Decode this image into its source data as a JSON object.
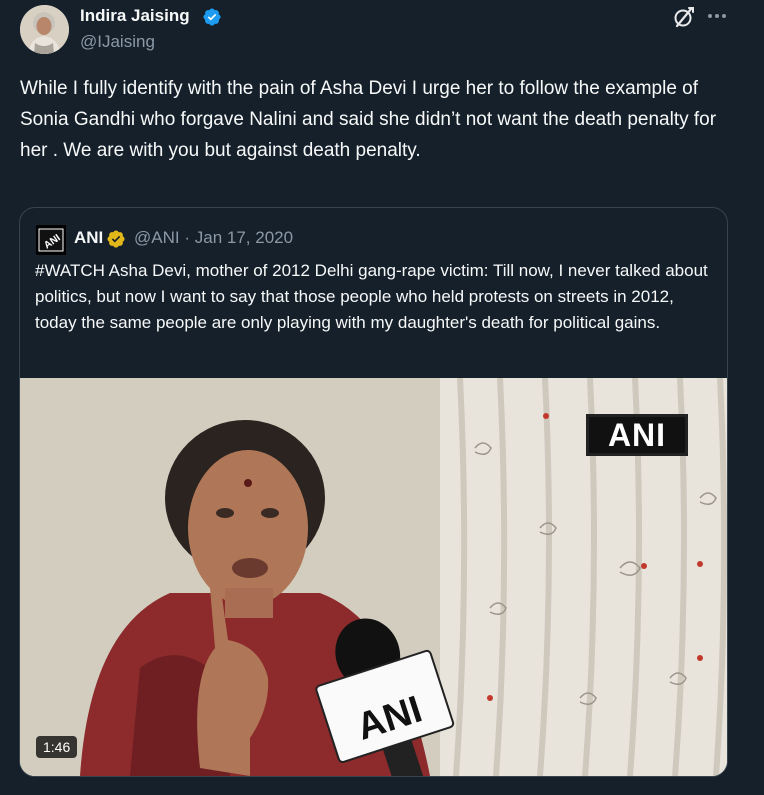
{
  "tweet": {
    "author_name": "Indira Jaising",
    "handle": "@IJaising",
    "text": "While I fully identify with the pain of Asha Devi I urge her to follow the example of Sonia Gandhi who forgave Nalini and said she didn’t not want the death penalty for her . We are with you but against death penalty.",
    "avatar_icon": "profile-photo",
    "verified_color": "#1d9bf0",
    "grok_icon": "grok-icon",
    "more_icon": "more-icon"
  },
  "quote": {
    "author_name": "ANI",
    "handle": "@ANI",
    "separator": "·",
    "date": "Jan 17, 2020",
    "verified_color": "#e2b719",
    "text": "#WATCH Asha Devi, mother of 2012 Delhi gang-rape victim:  Till now, I never talked about politics, but now I want to say that those people who held protests on streets in 2012, today the same people are only playing with my daughter's death for political gains.",
    "media": {
      "watermark": "ANI",
      "mic_label": "ANI",
      "duration": "1:46"
    }
  },
  "colors": {
    "background": "#15202b",
    "border": "#38444d",
    "secondary_text": "#8b98a5"
  }
}
